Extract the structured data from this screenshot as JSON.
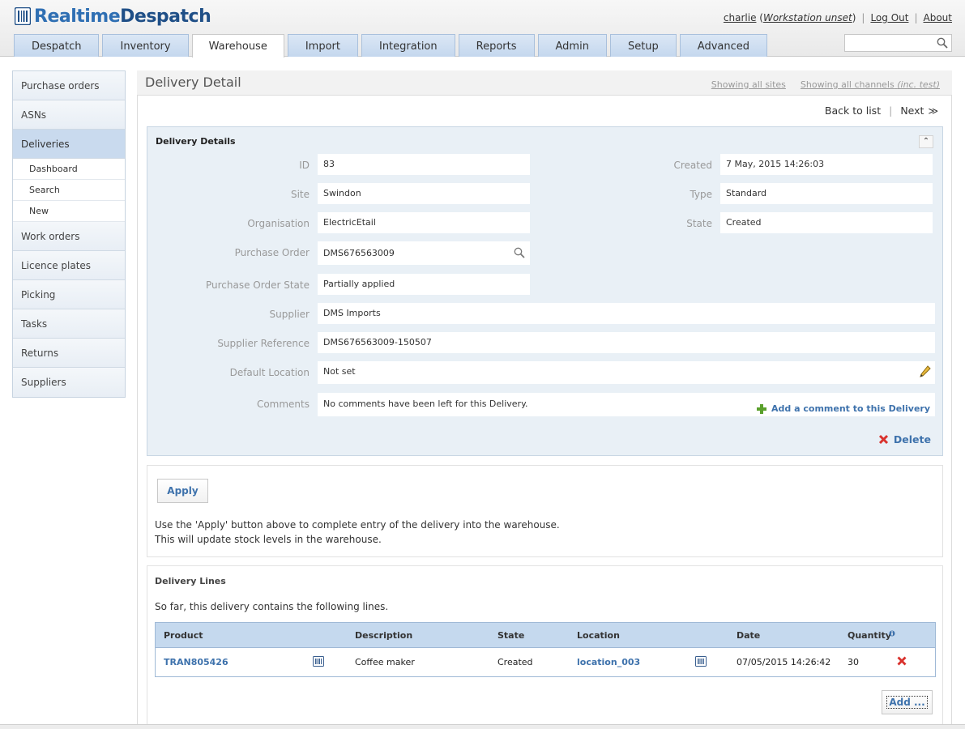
{
  "app": {
    "logo_a": "Realtime",
    "logo_b": "Despatch"
  },
  "user": {
    "name": "charlie",
    "workstation": "Workstation unset",
    "logout": "Log Out",
    "about": "About"
  },
  "tabs": [
    {
      "label": "Despatch"
    },
    {
      "label": "Inventory"
    },
    {
      "label": "Warehouse",
      "active": true
    },
    {
      "label": "Import"
    },
    {
      "label": "Integration"
    },
    {
      "label": "Reports"
    },
    {
      "label": "Admin"
    },
    {
      "label": "Setup"
    },
    {
      "label": "Advanced"
    }
  ],
  "search": {
    "placeholder": "",
    "value": ""
  },
  "sidebar": {
    "items": [
      {
        "label": "Purchase orders"
      },
      {
        "label": "ASNs"
      },
      {
        "label": "Deliveries"
      },
      {
        "label": "Work orders"
      },
      {
        "label": "Licence plates"
      },
      {
        "label": "Picking"
      },
      {
        "label": "Tasks"
      },
      {
        "label": "Returns"
      },
      {
        "label": "Suppliers"
      }
    ],
    "subitems": [
      {
        "label": "Dashboard"
      },
      {
        "label": "Search"
      },
      {
        "label": "New"
      }
    ]
  },
  "page": {
    "title": "Delivery Detail",
    "filter_sites": "Showing all sites",
    "filter_channels": "Showing all channels",
    "filter_channels_suffix": "(inc. test)",
    "back": "Back to list",
    "next": "Next"
  },
  "details": {
    "title": "Delivery Details",
    "id_label": "ID",
    "id": "83",
    "site_label": "Site",
    "site": "Swindon",
    "org_label": "Organisation",
    "org": "ElectricEtail",
    "po_label": "Purchase Order",
    "po": "DMS676563009",
    "po_state_label": "Purchase Order State",
    "po_state": "Partially applied",
    "supplier_label": "Supplier",
    "supplier": "DMS Imports",
    "supplier_ref_label": "Supplier Reference",
    "supplier_ref": "DMS676563009-150507",
    "location_label": "Default Location",
    "location": "Not set",
    "comments_label": "Comments",
    "comments": "No comments have been left for this Delivery.",
    "add_comment": "Add a comment to this Delivery",
    "created_label": "Created",
    "created": "7 May, 2015 14:26:03",
    "type_label": "Type",
    "type": "Standard",
    "state_label": "State",
    "state": "Created",
    "delete": "Delete"
  },
  "apply": {
    "button": "Apply",
    "text1": "Use the 'Apply' button above to complete entry of the delivery into the warehouse.",
    "text2": "This will update stock levels in the warehouse."
  },
  "lines": {
    "title": "Delivery Lines",
    "intro": "So far, this delivery contains the following lines.",
    "headers": {
      "product": "Product",
      "description": "Description",
      "state": "State",
      "location": "Location",
      "date": "Date",
      "quantity": "Quantity"
    },
    "rows": [
      {
        "product": "TRAN805426",
        "description": "Coffee maker",
        "state": "Created",
        "location": "location_003",
        "date": "07/05/2015 14:26:42",
        "quantity": "30"
      }
    ],
    "add_button": "Add ..."
  },
  "colors": {
    "accent": "#3e72ac",
    "tab_bg": "#c4d7ee",
    "panel_bg": "#e9f0f6",
    "delete_red": "#d9322d",
    "add_green": "#5aa02c"
  }
}
